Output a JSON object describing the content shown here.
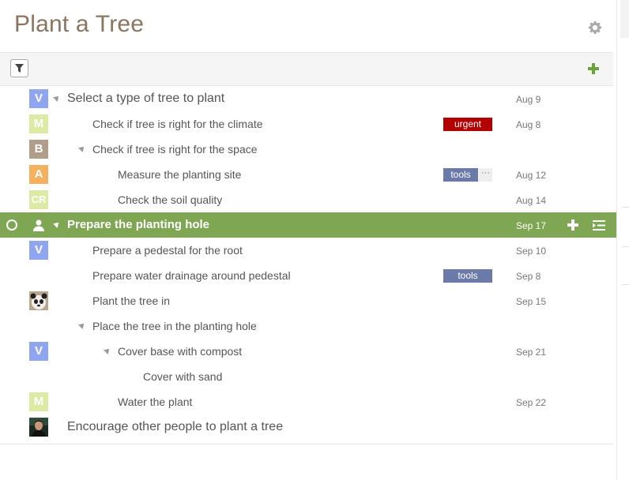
{
  "title": "Plant a Tree",
  "colors": {
    "accent": "#7fa653",
    "urgent": "#b20000",
    "tools": "#6b7aa8",
    "title": "#8a7560"
  },
  "toolbar": {
    "filter_icon": "filter-icon",
    "add_icon": "plus-icon"
  },
  "tasks": [
    {
      "avatar": "V",
      "avatar_color": "#8fa5f0",
      "label": "Select a type of tree to plant",
      "date": "Aug 9"
    },
    {
      "avatar": "M",
      "avatar_color": "#dceaa6",
      "label": "Check if tree is right for the climate",
      "tag": "urgent",
      "date": "Aug 8"
    },
    {
      "avatar": "B",
      "avatar_color": "#b09e8a",
      "label": "Check if tree is right for the space"
    },
    {
      "avatar": "A",
      "avatar_color": "#f5b060",
      "label": "Measure the planting site",
      "tag": "tools",
      "more": "···",
      "date": "Aug 12"
    },
    {
      "avatar": "CR",
      "avatar_color": "#dceaa6",
      "label": "Check the soil quality",
      "date": "Aug 14"
    },
    {
      "label": "Prepare the planting hole",
      "date": "Sep 17"
    },
    {
      "avatar": "V",
      "avatar_color": "#8fa5f0",
      "label": "Prepare a pedestal for the root",
      "date": "Sep 10"
    },
    {
      "label": "Prepare water drainage around pedestal",
      "tag": "tools",
      "date": "Sep 8"
    },
    {
      "avatar_icon": "panda-avatar",
      "label": "Plant the tree in",
      "date": "Sep 15"
    },
    {
      "label": "Place the tree in the planting hole"
    },
    {
      "avatar": "V",
      "avatar_color": "#8fa5f0",
      "label": "Cover base with compost",
      "date": "Sep 21"
    },
    {
      "label": "Cover with sand"
    },
    {
      "avatar": "M",
      "avatar_color": "#dceaa6",
      "label": "Water the plant",
      "date": "Sep 22"
    },
    {
      "avatar_icon": "person-photo-avatar",
      "label": "Encourage other people to plant a tree"
    }
  ]
}
